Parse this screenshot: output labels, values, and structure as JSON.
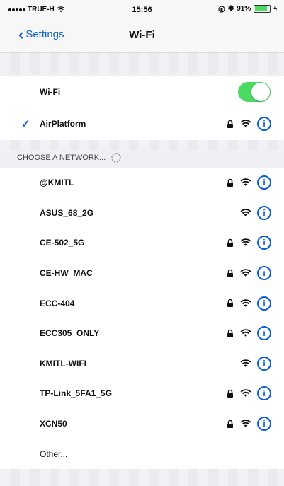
{
  "status_bar": {
    "carrier": "TRUE-H",
    "time": "15:56",
    "battery_percent": "91%"
  },
  "nav": {
    "back_label": "Settings",
    "title": "Wi-Fi"
  },
  "wifi_toggle": {
    "label": "Wi-Fi",
    "on": true
  },
  "connected": {
    "name": "AirPlatform",
    "secured": true
  },
  "section_header": "CHOOSE A NETWORK...",
  "networks": [
    {
      "name": "@KMITL",
      "secured": true
    },
    {
      "name": "ASUS_68_2G",
      "secured": false
    },
    {
      "name": "CE-502_5G",
      "secured": true
    },
    {
      "name": "CE-HW_MAC",
      "secured": true
    },
    {
      "name": "ECC-404",
      "secured": true
    },
    {
      "name": "ECC305_ONLY",
      "secured": true
    },
    {
      "name": "KMITL-WIFI",
      "secured": false
    },
    {
      "name": "TP-Link_5FA1_5G",
      "secured": true
    },
    {
      "name": "XCN50",
      "secured": true
    }
  ],
  "other_label": "Other...",
  "info_glyph": "i",
  "colors": {
    "accent": "#0b5ed7",
    "toggle_on": "#4cd964"
  }
}
